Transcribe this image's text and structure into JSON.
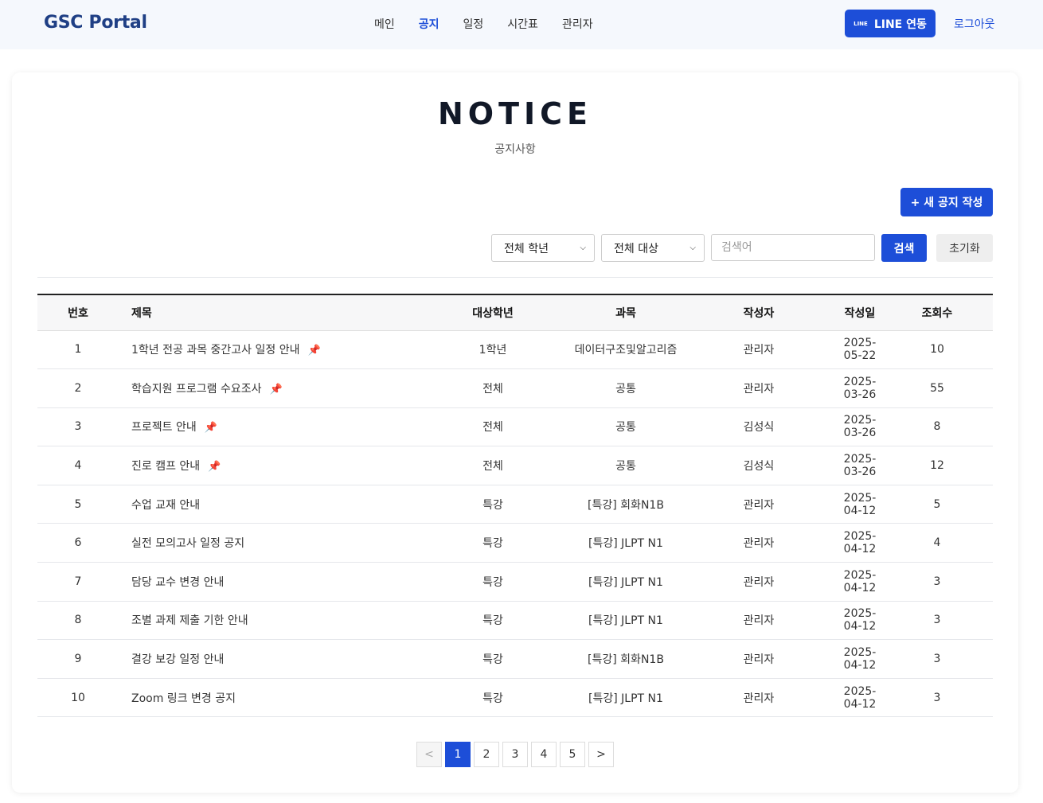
{
  "header": {
    "brand": "GSC Portal",
    "nav": [
      {
        "label": "메인",
        "active": false
      },
      {
        "label": "공지",
        "active": true
      },
      {
        "label": "일정",
        "active": false
      },
      {
        "label": "시간표",
        "active": false
      },
      {
        "label": "관리자",
        "active": false
      }
    ],
    "line_button": {
      "icon_text": "LINE",
      "label": "LINE 연동"
    },
    "logout": "로그아웃"
  },
  "page": {
    "title": "NOTICE",
    "subtitle": "공지사항",
    "new_button": "+ 새 공지 작성"
  },
  "filters": {
    "grade": "전체 학년",
    "target": "전체 대상",
    "search_placeholder": "검색어",
    "search_button": "검색",
    "reset_button": "초기화"
  },
  "table": {
    "columns": [
      "번호",
      "제목",
      "대상학년",
      "과목",
      "작성자",
      "작성일",
      "조회수"
    ],
    "rows": [
      {
        "no": "1",
        "title": "1학년 전공 과목 중간고사 일정 안내",
        "pinned": true,
        "grade": "1학년",
        "subject": "데이터구조및알고리즘",
        "author": "관리자",
        "date": "2025-05-22",
        "views": "10"
      },
      {
        "no": "2",
        "title": "학습지원 프로그램 수요조사",
        "pinned": true,
        "grade": "전체",
        "subject": "공통",
        "author": "관리자",
        "date": "2025-03-26",
        "views": "55"
      },
      {
        "no": "3",
        "title": "프로젝트 안내",
        "pinned": true,
        "grade": "전체",
        "subject": "공통",
        "author": "김성식",
        "date": "2025-03-26",
        "views": "8"
      },
      {
        "no": "4",
        "title": "진로 캠프 안내",
        "pinned": true,
        "grade": "전체",
        "subject": "공통",
        "author": "김성식",
        "date": "2025-03-26",
        "views": "12"
      },
      {
        "no": "5",
        "title": "수업 교재 안내",
        "pinned": false,
        "grade": "특강",
        "subject": "[특강] 회화N1B",
        "author": "관리자",
        "date": "2025-04-12",
        "views": "5"
      },
      {
        "no": "6",
        "title": "실전 모의고사 일정 공지",
        "pinned": false,
        "grade": "특강",
        "subject": "[특강] JLPT N1",
        "author": "관리자",
        "date": "2025-04-12",
        "views": "4"
      },
      {
        "no": "7",
        "title": "담당 교수 변경 안내",
        "pinned": false,
        "grade": "특강",
        "subject": "[특강] JLPT N1",
        "author": "관리자",
        "date": "2025-04-12",
        "views": "3"
      },
      {
        "no": "8",
        "title": "조별 과제 제출 기한 안내",
        "pinned": false,
        "grade": "특강",
        "subject": "[특강] JLPT N1",
        "author": "관리자",
        "date": "2025-04-12",
        "views": "3"
      },
      {
        "no": "9",
        "title": "결강 보강 일정 안내",
        "pinned": false,
        "grade": "특강",
        "subject": "[특강] 회화N1B",
        "author": "관리자",
        "date": "2025-04-12",
        "views": "3"
      },
      {
        "no": "10",
        "title": "Zoom 링크 변경 공지",
        "pinned": false,
        "grade": "특강",
        "subject": "[특강] JLPT N1",
        "author": "관리자",
        "date": "2025-04-12",
        "views": "3"
      }
    ]
  },
  "pagination": {
    "prev": "<",
    "next": ">",
    "pages": [
      "1",
      "2",
      "3",
      "4",
      "5"
    ],
    "current": "1"
  },
  "colors": {
    "accent": "#1d4ed8",
    "brand": "#1f3f85",
    "pin": "#e11d48",
    "header_bg": "#f5f8fd"
  },
  "icons": {
    "pin": "pushpin-icon",
    "chevron": "chevron-down-icon"
  }
}
